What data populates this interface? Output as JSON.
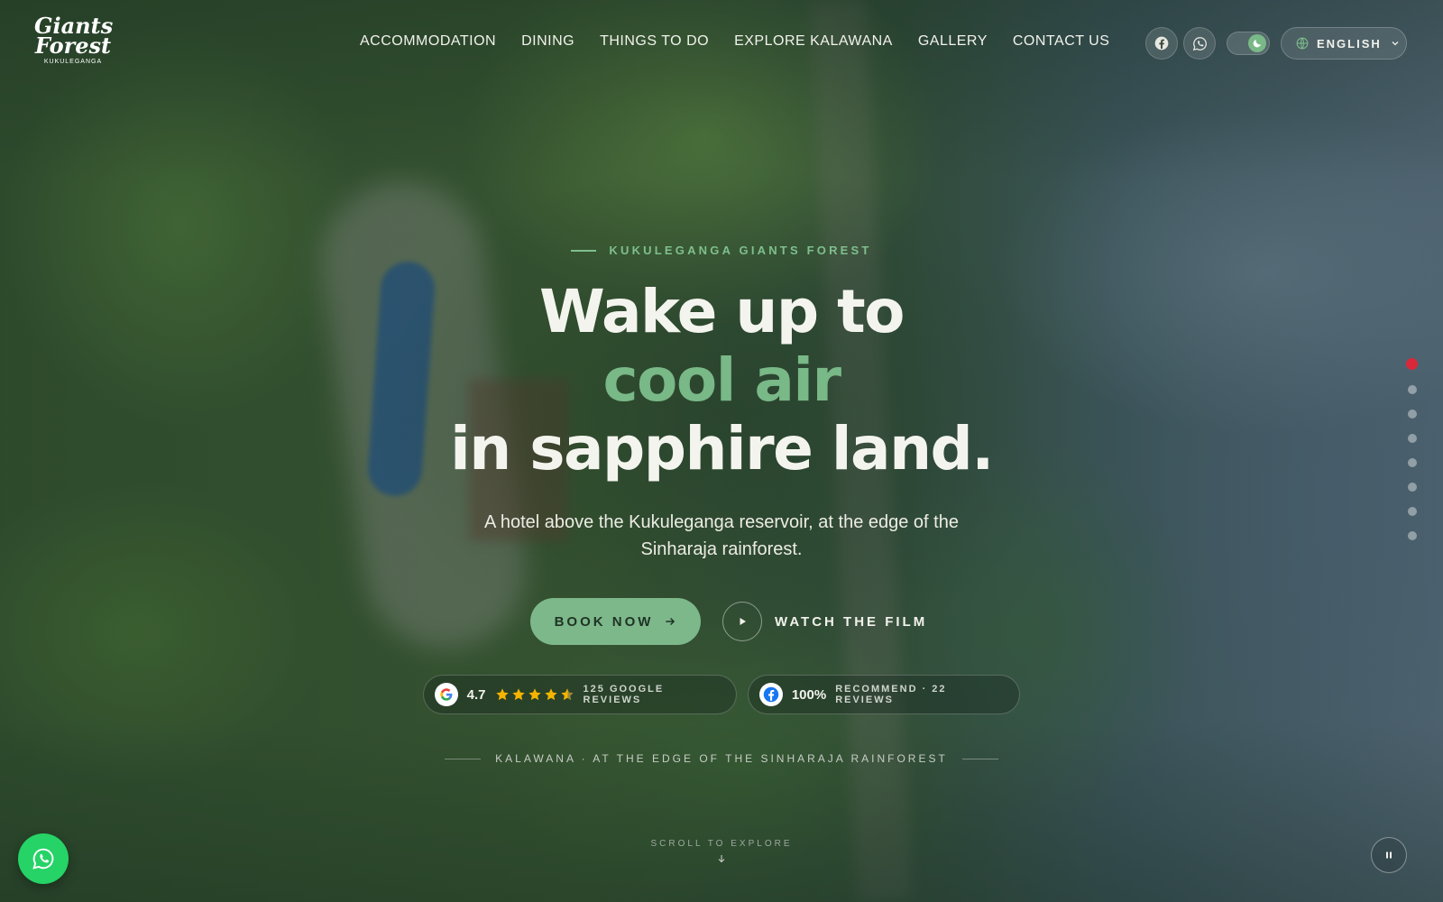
{
  "brand": {
    "logo_script": "Giants Forest",
    "logo_sub": "KUKULEGANGA"
  },
  "nav": {
    "items": [
      {
        "label": "ACCOMMODATION"
      },
      {
        "label": "DINING"
      },
      {
        "label": "THINGS TO DO"
      },
      {
        "label": "EXPLORE KALAWANA"
      },
      {
        "label": "GALLERY"
      },
      {
        "label": "CONTACT US"
      }
    ],
    "social": [
      {
        "icon": "facebook-icon"
      },
      {
        "icon": "whatsapp-icon"
      }
    ],
    "theme_toggle": {
      "icon": "moon-icon",
      "state": "dark"
    },
    "language": {
      "label": "ENGLISH",
      "icon": "globe-icon"
    }
  },
  "hero": {
    "eyebrow": "KUKULEGANGA GIANTS FOREST",
    "headline": {
      "line1": "Wake up to",
      "line2": "cool air",
      "line3": "in sapphire land."
    },
    "tagline": "A hotel above the Kukuleganga reservoir, at the edge of the Sinharaja rainforest.",
    "book_label": "BOOK NOW",
    "film_label": "WATCH THE FILM"
  },
  "reviews": {
    "google": {
      "rating": "4.7",
      "stars": 4.5,
      "label": "125 GOOGLE REVIEWS"
    },
    "facebook": {
      "percent": "100%",
      "label": "RECOMMEND · 22 REVIEWS"
    }
  },
  "location_line": "KALAWANA · AT THE EDGE OF THE SINHARAJA RAINFOREST",
  "scroll_hint": "SCROLL TO EXPLORE",
  "slider": {
    "count": 8,
    "active_index": 0
  },
  "colors": {
    "accent": "#7db88a",
    "accent_text": "#79b887",
    "active_dot": "#d8283a",
    "whatsapp": "#25d366"
  }
}
